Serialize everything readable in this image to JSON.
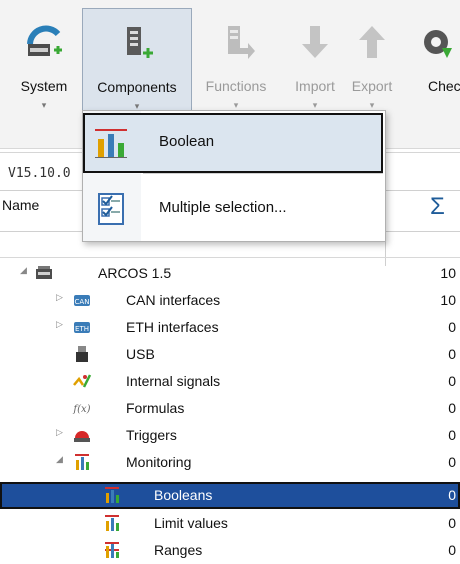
{
  "ribbon": {
    "buttons": [
      {
        "label": "System",
        "icon": "system-icon",
        "state": "normal"
      },
      {
        "label": "Components",
        "icon": "components-icon",
        "state": "active"
      },
      {
        "label": "Functions",
        "icon": "functions-icon",
        "state": "disabled"
      },
      {
        "label": "Import",
        "icon": "import-icon",
        "state": "disabled"
      },
      {
        "label": "Export",
        "icon": "export-icon",
        "state": "disabled"
      },
      {
        "label": "Chec",
        "icon": "check-icon",
        "state": "normal"
      }
    ],
    "dropdown_arrow": "▾"
  },
  "version": "V15.10.0",
  "table": {
    "header_name": "Name",
    "header_sum": "Σ"
  },
  "dropdown": {
    "items": [
      {
        "label": "Boolean",
        "icon": "boolean-chart-icon"
      },
      {
        "label": "Multiple selection...",
        "icon": "multiple-selection-icon"
      }
    ]
  },
  "tree": {
    "rows": [
      {
        "label": "ARCOS 1.5",
        "value": "10",
        "icon": "device-icon",
        "expander": "◢"
      },
      {
        "label": "CAN interfaces",
        "value": "10",
        "icon": "can-icon",
        "expander": "▷"
      },
      {
        "label": "ETH interfaces",
        "value": "0",
        "icon": "eth-icon",
        "expander": "▷"
      },
      {
        "label": "USB",
        "value": "0",
        "icon": "usb-icon",
        "expander": ""
      },
      {
        "label": "Internal signals",
        "value": "0",
        "icon": "internal-signals-icon",
        "expander": ""
      },
      {
        "label": "Formulas",
        "value": "0",
        "icon": "formula-icon",
        "expander": ""
      },
      {
        "label": "Triggers",
        "value": "0",
        "icon": "trigger-icon",
        "expander": "▷"
      },
      {
        "label": "Monitoring",
        "value": "0",
        "icon": "monitoring-icon",
        "expander": "◢"
      },
      {
        "label": "Booleans",
        "value": "0",
        "icon": "booleans-icon",
        "expander": ""
      },
      {
        "label": "Limit values",
        "value": "0",
        "icon": "limit-values-icon",
        "expander": ""
      },
      {
        "label": "Ranges",
        "value": "0",
        "icon": "ranges-icon",
        "expander": ""
      }
    ]
  },
  "colors": {
    "selection": "#1e4f9c",
    "accent_green": "#3aa935",
    "sum_blue": "#1f5c99"
  }
}
